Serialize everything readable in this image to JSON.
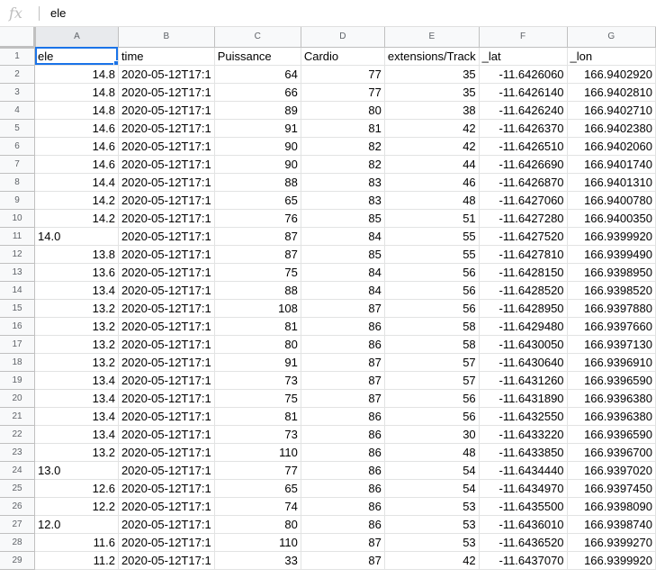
{
  "formula_bar": {
    "icon": "fx-icon",
    "value": "ele"
  },
  "columns": [
    "A",
    "B",
    "C",
    "D",
    "E",
    "F",
    "G"
  ],
  "header_row": [
    "ele",
    "time",
    "Puissance",
    "Cardio",
    "extensions/Track",
    "_lat",
    "_lon"
  ],
  "rows": [
    [
      "14.8",
      "2020-05-12T17:1",
      "64",
      "77",
      "35",
      "-11.6426060",
      "166.9402920"
    ],
    [
      "14.8",
      "2020-05-12T17:1",
      "66",
      "77",
      "35",
      "-11.6426140",
      "166.9402810"
    ],
    [
      "14.8",
      "2020-05-12T17:1",
      "89",
      "80",
      "38",
      "-11.6426240",
      "166.9402710"
    ],
    [
      "14.6",
      "2020-05-12T17:1",
      "91",
      "81",
      "42",
      "-11.6426370",
      "166.9402380"
    ],
    [
      "14.6",
      "2020-05-12T17:1",
      "90",
      "82",
      "42",
      "-11.6426510",
      "166.9402060"
    ],
    [
      "14.6",
      "2020-05-12T17:1",
      "90",
      "82",
      "44",
      "-11.6426690",
      "166.9401740"
    ],
    [
      "14.4",
      "2020-05-12T17:1",
      "88",
      "83",
      "46",
      "-11.6426870",
      "166.9401310"
    ],
    [
      "14.2",
      "2020-05-12T17:1",
      "65",
      "83",
      "48",
      "-11.6427060",
      "166.9400780"
    ],
    [
      "14.2",
      "2020-05-12T17:1",
      "76",
      "85",
      "51",
      "-11.6427280",
      "166.9400350"
    ],
    [
      "14.0",
      "2020-05-12T17:1",
      "87",
      "84",
      "55",
      "-11.6427520",
      "166.9399920"
    ],
    [
      "13.8",
      "2020-05-12T17:1",
      "87",
      "85",
      "55",
      "-11.6427810",
      "166.9399490"
    ],
    [
      "13.6",
      "2020-05-12T17:1",
      "75",
      "84",
      "56",
      "-11.6428150",
      "166.9398950"
    ],
    [
      "13.4",
      "2020-05-12T17:1",
      "88",
      "84",
      "56",
      "-11.6428520",
      "166.9398520"
    ],
    [
      "13.2",
      "2020-05-12T17:1",
      "108",
      "87",
      "56",
      "-11.6428950",
      "166.9397880"
    ],
    [
      "13.2",
      "2020-05-12T17:1",
      "81",
      "86",
      "58",
      "-11.6429480",
      "166.9397660"
    ],
    [
      "13.2",
      "2020-05-12T17:1",
      "80",
      "86",
      "58",
      "-11.6430050",
      "166.9397130"
    ],
    [
      "13.2",
      "2020-05-12T17:1",
      "91",
      "87",
      "57",
      "-11.6430640",
      "166.9396910"
    ],
    [
      "13.4",
      "2020-05-12T17:1",
      "73",
      "87",
      "57",
      "-11.6431260",
      "166.9396590"
    ],
    [
      "13.4",
      "2020-05-12T17:1",
      "75",
      "87",
      "56",
      "-11.6431890",
      "166.9396380"
    ],
    [
      "13.4",
      "2020-05-12T17:1",
      "81",
      "86",
      "56",
      "-11.6432550",
      "166.9396380"
    ],
    [
      "13.4",
      "2020-05-12T17:1",
      "73",
      "86",
      "30",
      "-11.6433220",
      "166.9396590"
    ],
    [
      "13.2",
      "2020-05-12T17:1",
      "110",
      "86",
      "48",
      "-11.6433850",
      "166.9396700"
    ],
    [
      "13.0",
      "2020-05-12T17:1",
      "77",
      "86",
      "54",
      "-11.6434440",
      "166.9397020"
    ],
    [
      "12.6",
      "2020-05-12T17:1",
      "65",
      "86",
      "54",
      "-11.6434970",
      "166.9397450"
    ],
    [
      "12.2",
      "2020-05-12T17:1",
      "74",
      "86",
      "53",
      "-11.6435500",
      "166.9398090"
    ],
    [
      "12.0",
      "2020-05-12T17:1",
      "80",
      "86",
      "53",
      "-11.6436010",
      "166.9398740"
    ],
    [
      "11.6",
      "2020-05-12T17:1",
      "110",
      "87",
      "53",
      "-11.6436520",
      "166.9399270"
    ],
    [
      "11.2",
      "2020-05-12T17:1",
      "33",
      "87",
      "42",
      "-11.6437070",
      "166.9399920"
    ]
  ],
  "left_aligned_ele_rows": [
    9,
    22,
    25
  ]
}
